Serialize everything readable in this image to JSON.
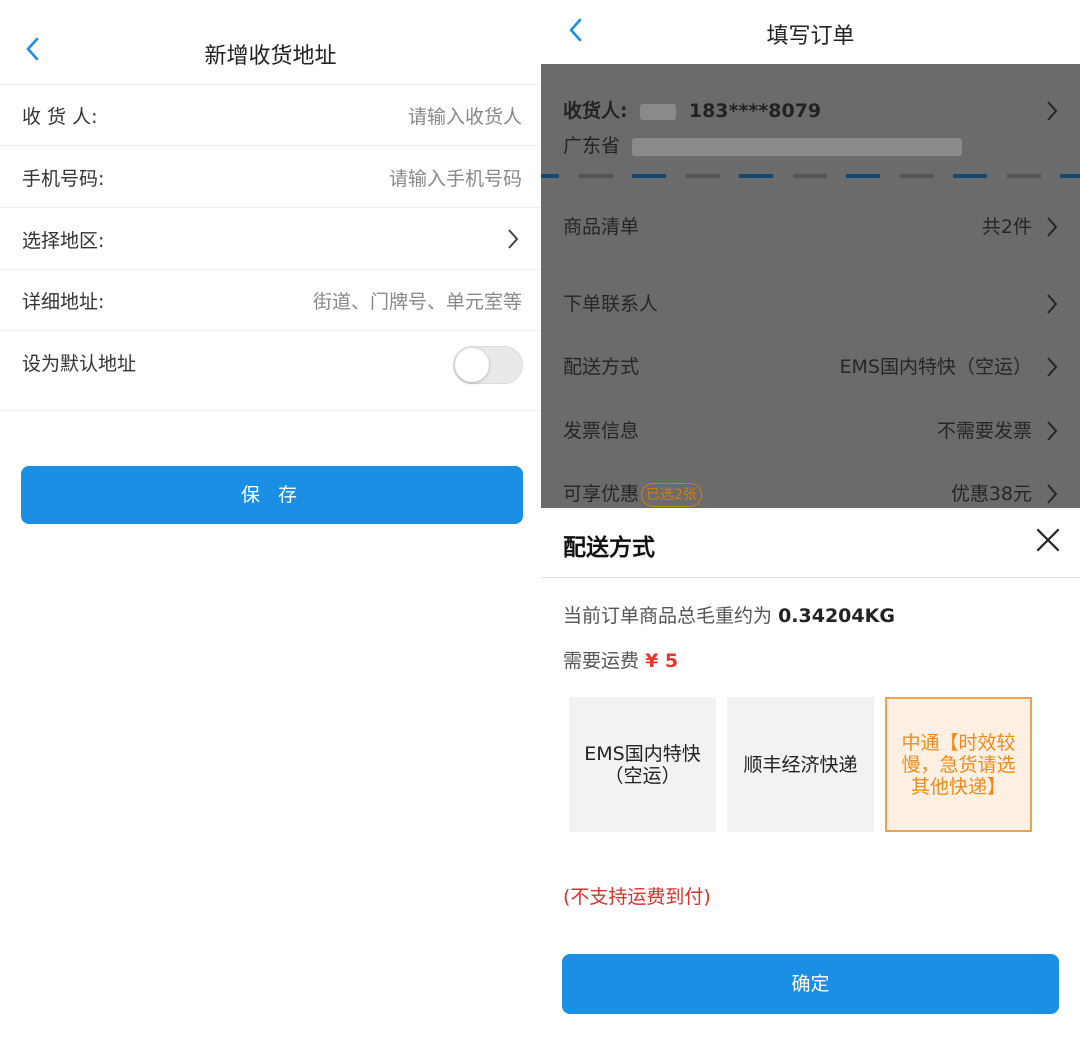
{
  "left": {
    "title": "新增收货地址",
    "fields": [
      {
        "label": "收 货 人:",
        "placeholder": "请输入收货人"
      },
      {
        "label": "手机号码:",
        "placeholder": "请输入手机号码"
      },
      {
        "label": "选择地区:"
      },
      {
        "label": "详细地址:",
        "placeholder": "街道、门牌号、单元室等"
      }
    ],
    "default_label": "设为默认地址",
    "default_on": false,
    "save_label": "保 存"
  },
  "right": {
    "title": "填写订单",
    "address": {
      "label": "收货人:",
      "phone": "183****8079",
      "province": "广东省"
    },
    "rows": [
      {
        "label": "商品清单",
        "value": "共2件"
      },
      {
        "label": "下单联系人",
        "value": ""
      },
      {
        "label": "配送方式",
        "value": "EMS国内特快（空运）"
      },
      {
        "label": "发票信息",
        "value": "不需要发票"
      },
      {
        "label": "可享优惠",
        "badge": "已选2张",
        "value": "优惠38元"
      }
    ],
    "sheet": {
      "title": "配送方式",
      "weight_text": "当前订单商品总毛重约为",
      "weight_value": "0.34204KG",
      "fee_text": "需要运费",
      "fee_value": "¥ 5",
      "options": [
        {
          "label": "EMS国内特快（空运）",
          "selected": false
        },
        {
          "label": "顺丰经济快递",
          "selected": false
        },
        {
          "label": "中通【时效较慢，急货请选其他快递】",
          "selected": true
        }
      ],
      "note": "(不支持运费到付)",
      "confirm_label": "确定"
    }
  },
  "colors": {
    "accent": "#1a8fe3",
    "price_red": "#e5372b",
    "selected_orange": "#ee8b1c",
    "overlay": "#6b6b6b"
  }
}
